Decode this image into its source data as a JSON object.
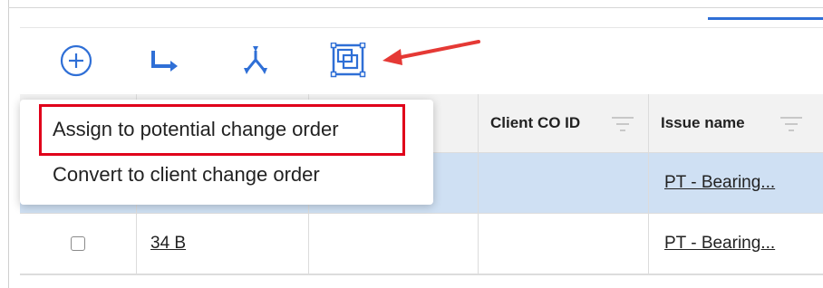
{
  "toolbar": {
    "icons": [
      "add-circle-icon",
      "route-arrow-icon",
      "merge-arrows-icon",
      "select-frame-icon"
    ],
    "accent_color": "#2f6fd6",
    "annotation_arrow_color": "#e53935"
  },
  "menu": {
    "items": [
      {
        "label": "Assign to potential change order",
        "highlighted": true
      },
      {
        "label": "Convert to client change order",
        "highlighted": false
      }
    ],
    "highlight_color": "#e0001a"
  },
  "table": {
    "columns": [
      {
        "label": ""
      },
      {
        "label": ""
      },
      {
        "label": ""
      },
      {
        "label": "Client CO ID"
      },
      {
        "label": "Issue name"
      }
    ],
    "rows": [
      {
        "selected": true,
        "number": "",
        "issue_name": "PT - Bearing..."
      },
      {
        "selected": false,
        "number": "34 B",
        "issue_name": "PT - Bearing..."
      }
    ],
    "selected_row_color": "#cfe0f3"
  }
}
